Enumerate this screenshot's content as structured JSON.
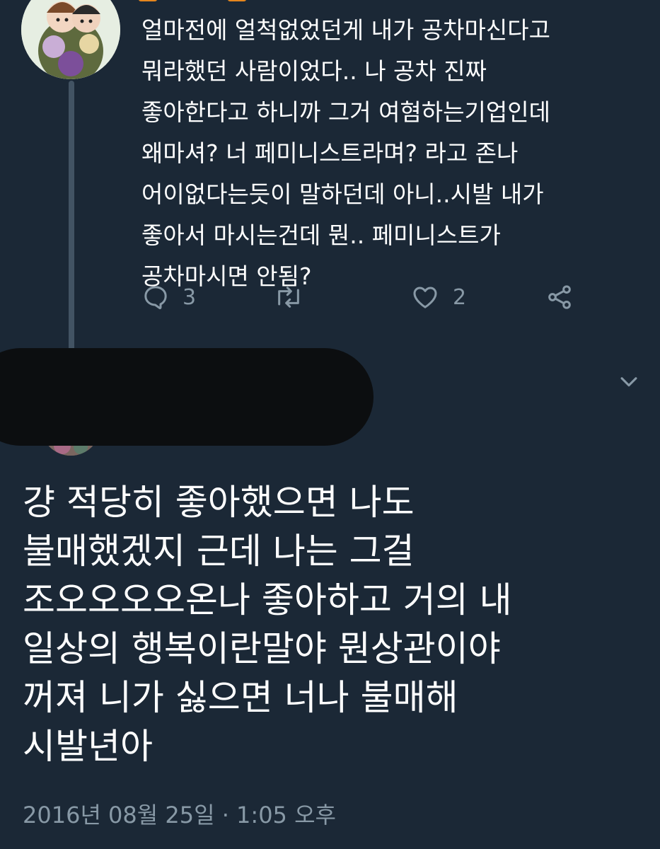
{
  "reply_tweet": {
    "text": "얼마전에 얼척없었던게 내가 공차마신다고\n뭐라했던 사람이었다.. 나 공차 진짜\n좋아한다고 하니까 그거 여혐하는기업인데\n왜마셔? 너 페미니스트라며? 라고 존나\n어이없다는듯이 말하던데 아니..시발 내가\n좋아서 마시는건데 뭔.. 페미니스트가\n공차마시면 안됨?",
    "actions": {
      "reply_icon": "speech-bubble-icon",
      "reply_count": "3",
      "retweet_icon": "retweet-icon",
      "like_icon": "heart-icon",
      "like_count": "2",
      "share_icon": "share-icon"
    }
  },
  "main_tweet": {
    "text": "걍 적당히 좋아했으면 나도\n불매했겠지 근데 나는 그걸\n조오오오오온나 좋아하고 거의 내\n일상의 행복이란말야 뭔상관이야\n꺼져 니가 싫으면 너나 불매해\n시발년아",
    "timestamp": "2016년 08월 25일 · 1:05 오후",
    "menu_icon": "chevron-down-icon"
  },
  "colors": {
    "background": "#1b2836",
    "text": "#ffffff",
    "secondary_text": "#8899a6",
    "thread_line": "#425363",
    "censor": "#0c0e10"
  }
}
